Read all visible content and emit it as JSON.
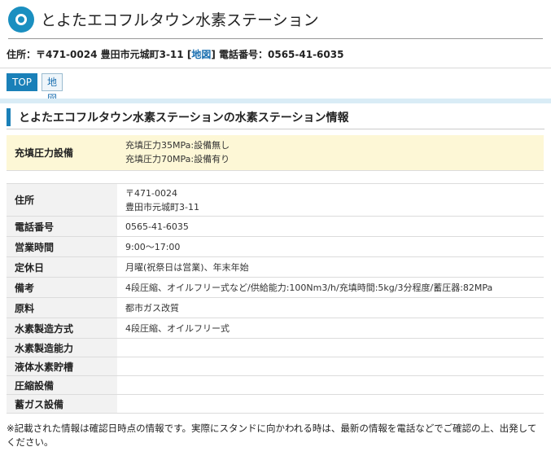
{
  "header": {
    "title": "とよたエコフルタウン水素ステーション",
    "address_prefix": "住所：〒471-0024 豊田市元城町3-11 [",
    "map_link": "地図",
    "address_suffix": "] 電話番号：0565-41-6035"
  },
  "nav": {
    "top_label": "TOP",
    "map_label": "地図"
  },
  "section": {
    "title": "とよたエコフルタウン水素ステーションの水素ステーション情報"
  },
  "pressure": {
    "label": "充填圧力設備",
    "line1": "充填圧力35MPa:設備無し",
    "line2": "充填圧力70MPa:設備有り"
  },
  "info": {
    "rows": [
      {
        "label": "住所",
        "line1": "〒471-0024",
        "line2": "豊田市元城町3-11"
      },
      {
        "label": "電話番号",
        "line1": "0565-41-6035",
        "line2": ""
      },
      {
        "label": "営業時間",
        "line1": "9:00～17:00",
        "line2": ""
      },
      {
        "label": "定休日",
        "line1": "月曜(祝祭日は営業)、年末年始",
        "line2": ""
      },
      {
        "label": "備考",
        "line1": "4段圧縮、オイルフリー式など/供給能力:100Nm3/h/充填時間:5kg/3分程度/蓄圧器:82MPa",
        "line2": ""
      },
      {
        "label": "原料",
        "line1": "都市ガス改質",
        "line2": ""
      },
      {
        "label": "水素製造方式",
        "line1": "4段圧縮、オイルフリー式",
        "line2": ""
      },
      {
        "label": "水素製造能力",
        "line1": "",
        "line2": ""
      },
      {
        "label": "液体水素貯槽",
        "line1": "",
        "line2": ""
      },
      {
        "label": "圧縮設備",
        "line1": "",
        "line2": ""
      },
      {
        "label": "蓄ガス設備",
        "line1": "",
        "line2": ""
      }
    ]
  },
  "footer": {
    "note": "※記載された情報は確認日時点の情報です。実際にスタンドに向かわれる時は、最新の情報を電話などでご確認の上、出発してください。"
  }
}
